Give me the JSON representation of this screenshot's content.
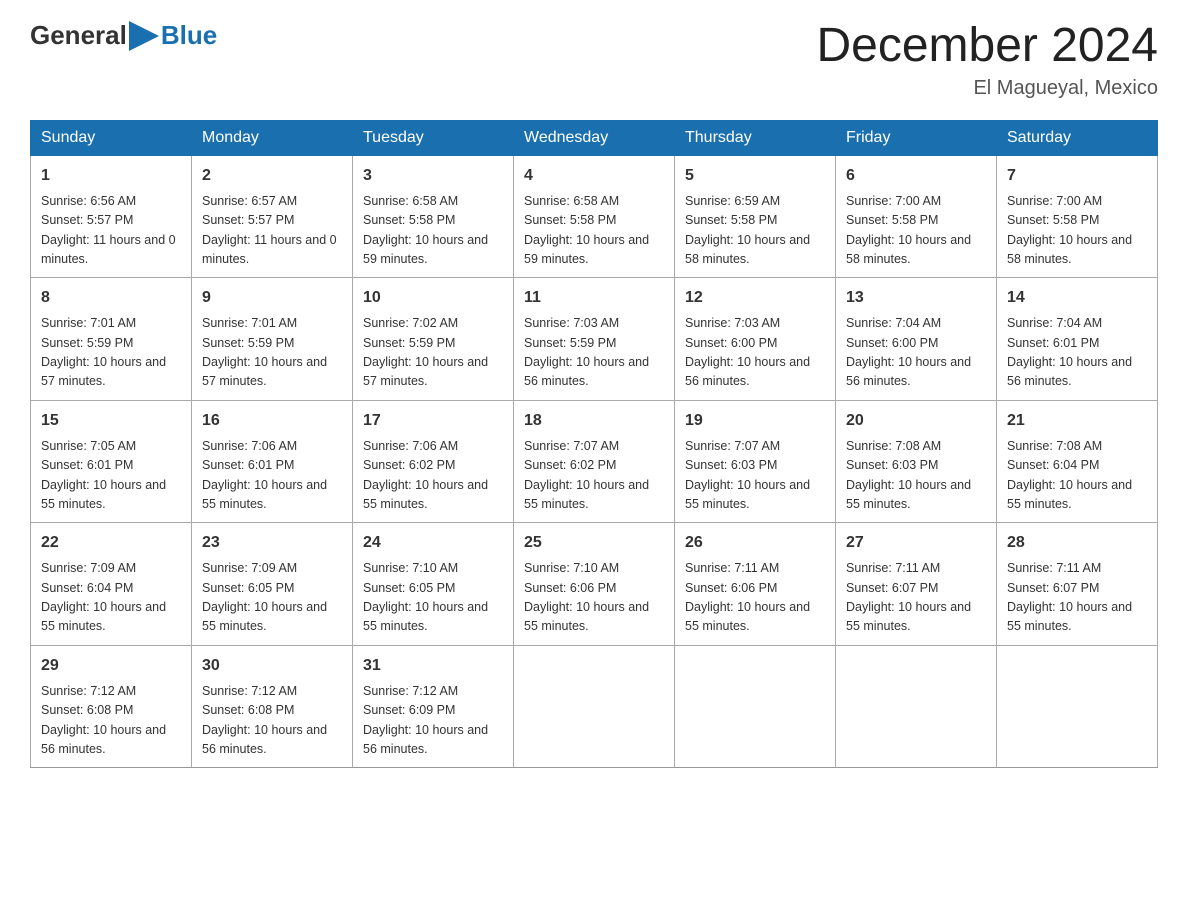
{
  "logo": {
    "general": "General",
    "blue": "Blue"
  },
  "title": "December 2024",
  "location": "El Magueyal, Mexico",
  "days_of_week": [
    "Sunday",
    "Monday",
    "Tuesday",
    "Wednesday",
    "Thursday",
    "Friday",
    "Saturday"
  ],
  "weeks": [
    [
      {
        "day": "1",
        "sunrise": "6:56 AM",
        "sunset": "5:57 PM",
        "daylight": "11 hours and 0 minutes."
      },
      {
        "day": "2",
        "sunrise": "6:57 AM",
        "sunset": "5:57 PM",
        "daylight": "11 hours and 0 minutes."
      },
      {
        "day": "3",
        "sunrise": "6:58 AM",
        "sunset": "5:58 PM",
        "daylight": "10 hours and 59 minutes."
      },
      {
        "day": "4",
        "sunrise": "6:58 AM",
        "sunset": "5:58 PM",
        "daylight": "10 hours and 59 minutes."
      },
      {
        "day": "5",
        "sunrise": "6:59 AM",
        "sunset": "5:58 PM",
        "daylight": "10 hours and 58 minutes."
      },
      {
        "day": "6",
        "sunrise": "7:00 AM",
        "sunset": "5:58 PM",
        "daylight": "10 hours and 58 minutes."
      },
      {
        "day": "7",
        "sunrise": "7:00 AM",
        "sunset": "5:58 PM",
        "daylight": "10 hours and 58 minutes."
      }
    ],
    [
      {
        "day": "8",
        "sunrise": "7:01 AM",
        "sunset": "5:59 PM",
        "daylight": "10 hours and 57 minutes."
      },
      {
        "day": "9",
        "sunrise": "7:01 AM",
        "sunset": "5:59 PM",
        "daylight": "10 hours and 57 minutes."
      },
      {
        "day": "10",
        "sunrise": "7:02 AM",
        "sunset": "5:59 PM",
        "daylight": "10 hours and 57 minutes."
      },
      {
        "day": "11",
        "sunrise": "7:03 AM",
        "sunset": "5:59 PM",
        "daylight": "10 hours and 56 minutes."
      },
      {
        "day": "12",
        "sunrise": "7:03 AM",
        "sunset": "6:00 PM",
        "daylight": "10 hours and 56 minutes."
      },
      {
        "day": "13",
        "sunrise": "7:04 AM",
        "sunset": "6:00 PM",
        "daylight": "10 hours and 56 minutes."
      },
      {
        "day": "14",
        "sunrise": "7:04 AM",
        "sunset": "6:01 PM",
        "daylight": "10 hours and 56 minutes."
      }
    ],
    [
      {
        "day": "15",
        "sunrise": "7:05 AM",
        "sunset": "6:01 PM",
        "daylight": "10 hours and 55 minutes."
      },
      {
        "day": "16",
        "sunrise": "7:06 AM",
        "sunset": "6:01 PM",
        "daylight": "10 hours and 55 minutes."
      },
      {
        "day": "17",
        "sunrise": "7:06 AM",
        "sunset": "6:02 PM",
        "daylight": "10 hours and 55 minutes."
      },
      {
        "day": "18",
        "sunrise": "7:07 AM",
        "sunset": "6:02 PM",
        "daylight": "10 hours and 55 minutes."
      },
      {
        "day": "19",
        "sunrise": "7:07 AM",
        "sunset": "6:03 PM",
        "daylight": "10 hours and 55 minutes."
      },
      {
        "day": "20",
        "sunrise": "7:08 AM",
        "sunset": "6:03 PM",
        "daylight": "10 hours and 55 minutes."
      },
      {
        "day": "21",
        "sunrise": "7:08 AM",
        "sunset": "6:04 PM",
        "daylight": "10 hours and 55 minutes."
      }
    ],
    [
      {
        "day": "22",
        "sunrise": "7:09 AM",
        "sunset": "6:04 PM",
        "daylight": "10 hours and 55 minutes."
      },
      {
        "day": "23",
        "sunrise": "7:09 AM",
        "sunset": "6:05 PM",
        "daylight": "10 hours and 55 minutes."
      },
      {
        "day": "24",
        "sunrise": "7:10 AM",
        "sunset": "6:05 PM",
        "daylight": "10 hours and 55 minutes."
      },
      {
        "day": "25",
        "sunrise": "7:10 AM",
        "sunset": "6:06 PM",
        "daylight": "10 hours and 55 minutes."
      },
      {
        "day": "26",
        "sunrise": "7:11 AM",
        "sunset": "6:06 PM",
        "daylight": "10 hours and 55 minutes."
      },
      {
        "day": "27",
        "sunrise": "7:11 AM",
        "sunset": "6:07 PM",
        "daylight": "10 hours and 55 minutes."
      },
      {
        "day": "28",
        "sunrise": "7:11 AM",
        "sunset": "6:07 PM",
        "daylight": "10 hours and 55 minutes."
      }
    ],
    [
      {
        "day": "29",
        "sunrise": "7:12 AM",
        "sunset": "6:08 PM",
        "daylight": "10 hours and 56 minutes."
      },
      {
        "day": "30",
        "sunrise": "7:12 AM",
        "sunset": "6:08 PM",
        "daylight": "10 hours and 56 minutes."
      },
      {
        "day": "31",
        "sunrise": "7:12 AM",
        "sunset": "6:09 PM",
        "daylight": "10 hours and 56 minutes."
      },
      null,
      null,
      null,
      null
    ]
  ]
}
